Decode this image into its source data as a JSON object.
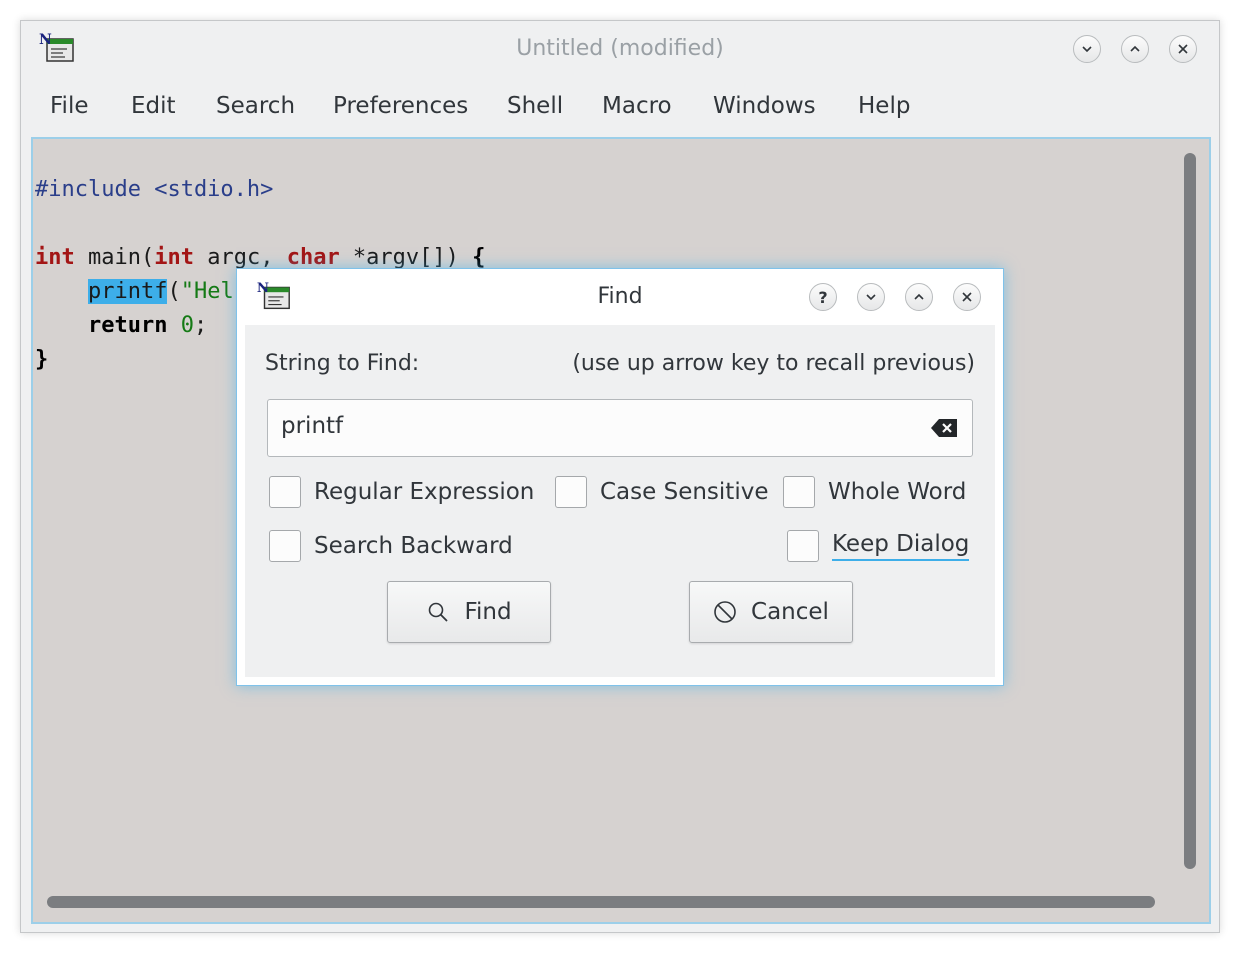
{
  "window": {
    "title": "Untitled (modified)",
    "controls": [
      "minimize",
      "maximize",
      "close"
    ]
  },
  "menubar": {
    "items": [
      "File",
      "Edit",
      "Search",
      "Preferences",
      "Shell",
      "Macro",
      "Windows",
      "Help"
    ]
  },
  "editor": {
    "lines": {
      "l1_pp": "#include <stdio.h>",
      "l3_kw_int": "int",
      "l3_main": " main(",
      "l3_kw_int2": "int",
      "l3_argc": " argc, ",
      "l3_kw_char": "char",
      "l3_rest": " *argv[]) ",
      "l3_brace": "{",
      "l4_indent": "    ",
      "l4_selected": "printf",
      "l4_paren": "(",
      "l4_str": "\"Hel",
      "l5_indent": "    ",
      "l5_return": "return",
      "l5_space": " ",
      "l5_zero": "0",
      "l5_semi": ";",
      "l6_brace": "}"
    }
  },
  "find_dialog": {
    "title": "Find",
    "string_label": "String to Find:",
    "hint": "(use up arrow key to recall previous)",
    "search_value": "printf",
    "checkboxes": {
      "regex": "Regular Expression",
      "case_sensitive": "Case Sensitive",
      "whole_word": "Whole Word",
      "search_backward": "Search Backward",
      "keep_dialog": "Keep Dialog"
    },
    "find_button": "Find",
    "cancel_button": "Cancel"
  },
  "colors": {
    "accent": "#3daee9",
    "editor_bg": "#d6d2d0",
    "keyword": "#a31515",
    "string": "#157a15",
    "preprocessor": "#2a3e8a"
  }
}
